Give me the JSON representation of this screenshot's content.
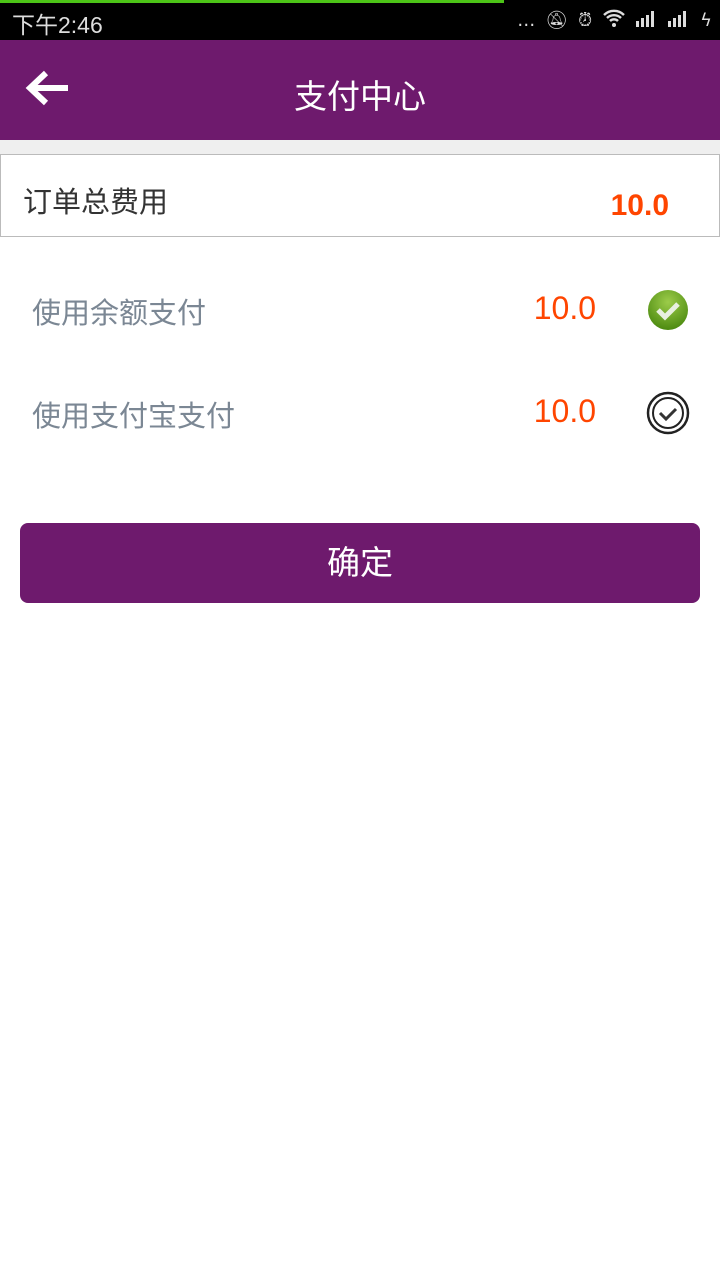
{
  "status_bar": {
    "time": "下午2:46",
    "icons": [
      "more-dots-icon",
      "alarm-off-icon",
      "alarm-clock-icon",
      "wifi-icon",
      "signal-icon",
      "signal-icon",
      "charging-icon"
    ]
  },
  "header": {
    "title": "支付中心",
    "back_icon": "arrow-left-icon"
  },
  "order_total": {
    "label": "订单总费用",
    "value": "10.0"
  },
  "payment_options": [
    {
      "label": "使用余额支付",
      "amount": "10.0",
      "checked": true
    },
    {
      "label": "使用支付宝支付",
      "amount": "10.0",
      "checked": false
    }
  ],
  "confirm_label": "确定",
  "colors": {
    "brand": "#6e1a6d",
    "amount": "#ff4500",
    "check_green": "#5a9a1a"
  }
}
